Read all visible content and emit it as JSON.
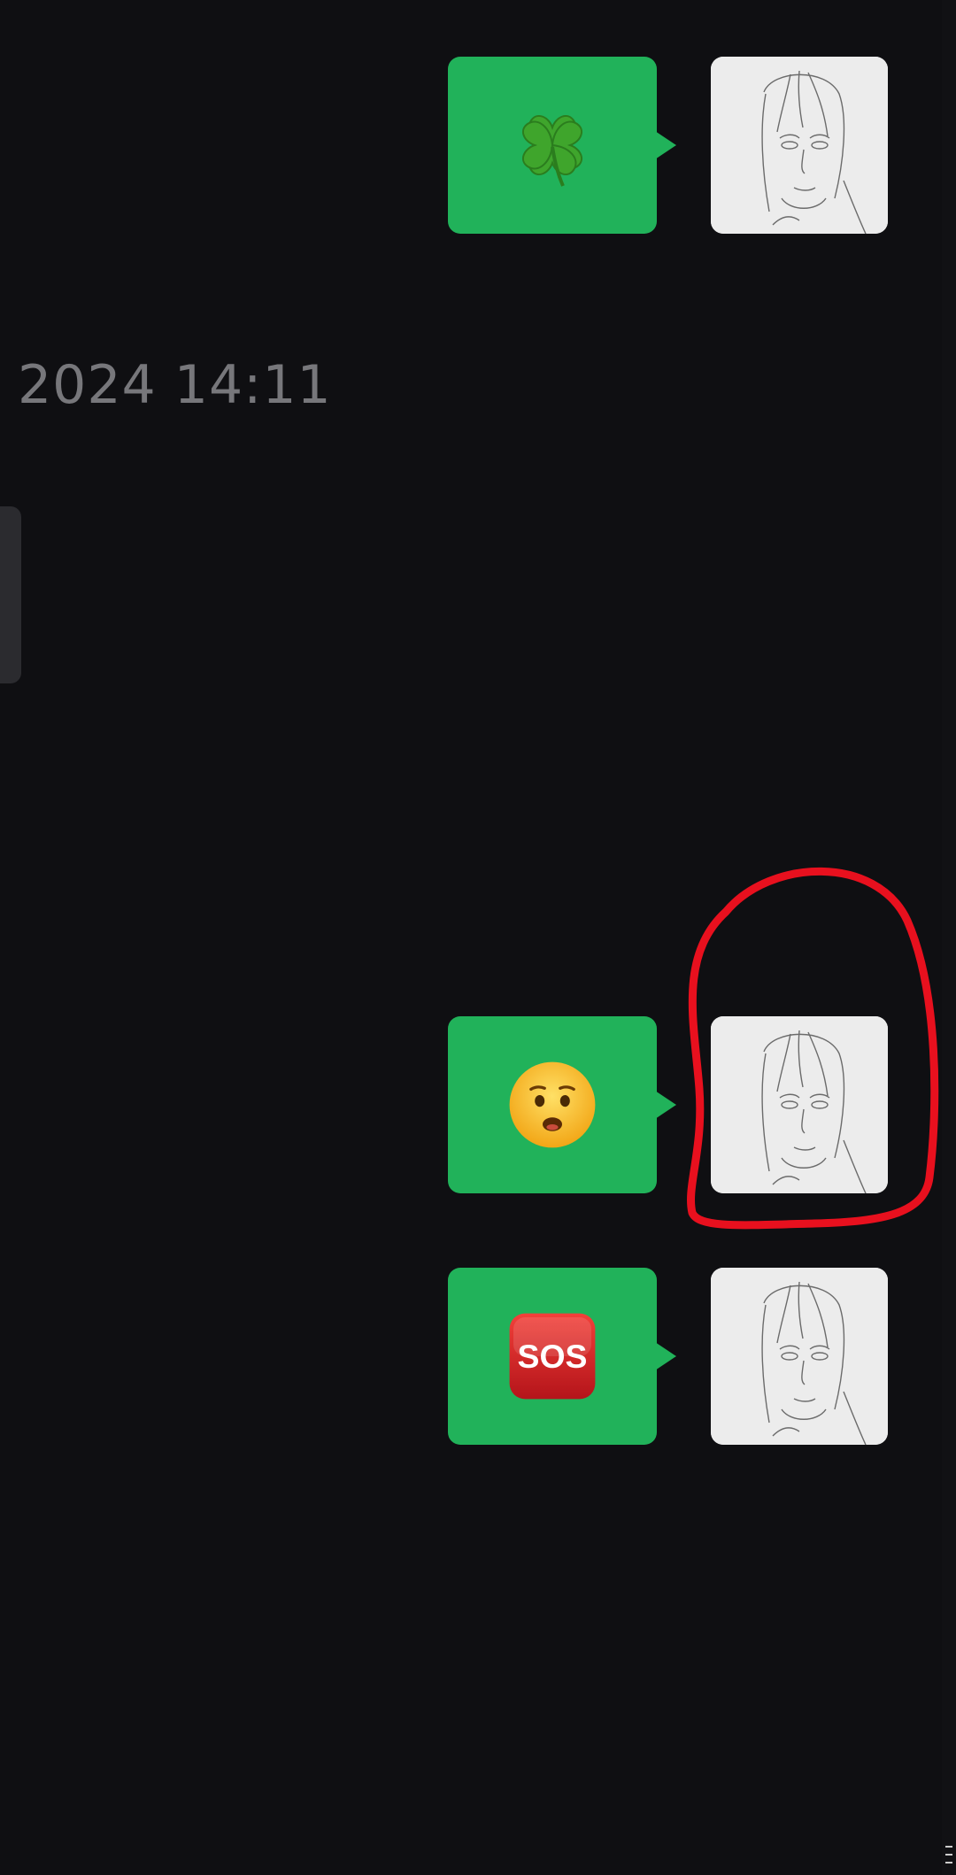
{
  "chat": {
    "timestamp": "2024 14:11",
    "messages": [
      {
        "sender": "self",
        "emoji": "four-leaf-clover",
        "bubble_color": "#21b25a"
      },
      {
        "sender": "self",
        "emoji": "anxious-face",
        "bubble_color": "#21b25a",
        "annotated": true
      },
      {
        "sender": "self",
        "emoji": "sos-button",
        "bubble_color": "#21b25a",
        "label": "SOS"
      }
    ]
  },
  "colors": {
    "background": "#0f0f12",
    "bubble": "#21b25a",
    "annotation": "#e8101e",
    "timestamp": "#77777b"
  }
}
